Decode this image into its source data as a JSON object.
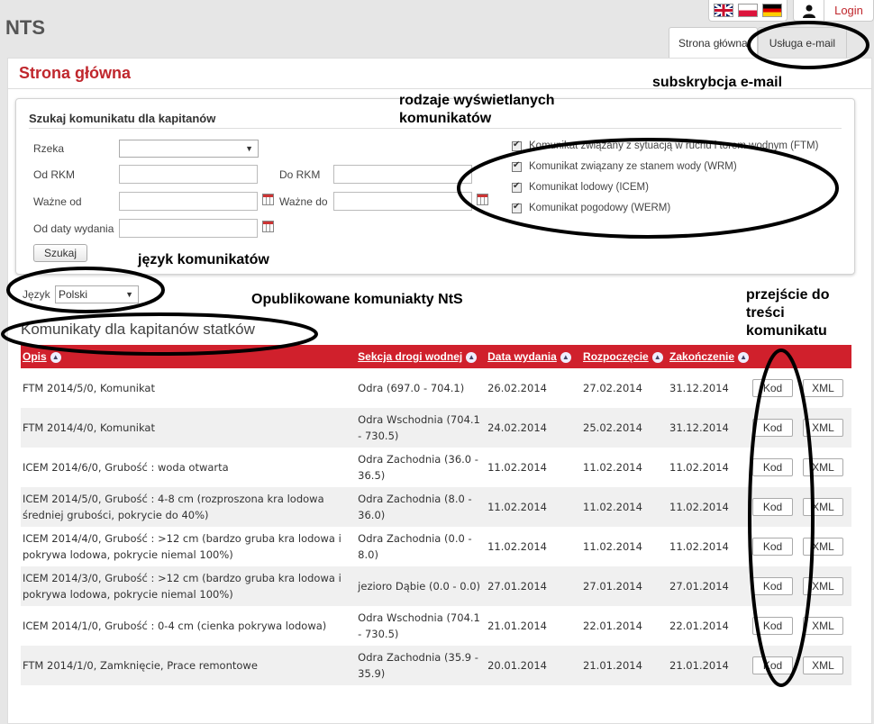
{
  "header": {
    "app_title": "NTS",
    "languages": [
      "flag-uk",
      "flag-pl",
      "flag-de"
    ],
    "login_label": "Login"
  },
  "tabs": [
    {
      "label": "Strona główna",
      "active": true
    },
    {
      "label": "Usługa e-mail",
      "active": false
    }
  ],
  "page": {
    "title": "Strona główna"
  },
  "search": {
    "legend": "Szukaj komunikatu dla kapitanów",
    "river_label": "Rzeka",
    "river_value": "",
    "from_rkm_label": "Od RKM",
    "to_rkm_label": "Do RKM",
    "valid_from_label": "Ważne od",
    "valid_to_label": "Ważne do",
    "issue_date_label": "Od daty wydania",
    "search_button": "Szukaj",
    "checkboxes": [
      {
        "label": "Komunikat związany z sytuacją w ruchu i torem wodnym (FTM)",
        "checked": true
      },
      {
        "label": "Komunikat związany ze stanem wody (WRM)",
        "checked": true
      },
      {
        "label": "Komunikat lodowy (ICEM)",
        "checked": true
      },
      {
        "label": "Komunikat pogodowy (WERM)",
        "checked": true
      }
    ]
  },
  "language_select": {
    "label": "Język",
    "value": "Polski"
  },
  "table": {
    "title": "Komunikaty dla kapitanów statków",
    "columns": [
      "Opis",
      "Sekcja drogi wodnej",
      "Data wydania",
      "Rozpoczęcie",
      "Zakończenie"
    ],
    "kod_label": "Kod",
    "xml_label": "XML",
    "rows": [
      {
        "opis": "FTM 2014/5/0, Komunikat",
        "sekcja": "Odra (697.0 - 704.1)",
        "wydania": "26.02.2014",
        "start": "27.02.2014",
        "end": "31.12.2014"
      },
      {
        "opis": "FTM 2014/4/0, Komunikat",
        "sekcja": "Odra Wschodnia (704.1 - 730.5)",
        "wydania": "24.02.2014",
        "start": "25.02.2014",
        "end": "31.12.2014"
      },
      {
        "opis": "ICEM 2014/6/0, Grubość : woda otwarta",
        "sekcja": "Odra Zachodnia (36.0 - 36.5)",
        "wydania": "11.02.2014",
        "start": "11.02.2014",
        "end": "11.02.2014"
      },
      {
        "opis": "ICEM 2014/5/0, Grubość : 4-8 cm (rozproszona kra lodowa średniej grubości, pokrycie do 40%)",
        "sekcja": "Odra Zachodnia (8.0 - 36.0)",
        "wydania": "11.02.2014",
        "start": "11.02.2014",
        "end": "11.02.2014"
      },
      {
        "opis": "ICEM 2014/4/0, Grubość : >12 cm (bardzo gruba kra lodowa i pokrywa lodowa, pokrycie niemal 100%)",
        "sekcja": "Odra Zachodnia (0.0 - 8.0)",
        "wydania": "11.02.2014",
        "start": "11.02.2014",
        "end": "11.02.2014"
      },
      {
        "opis": "ICEM 2014/3/0, Grubość : >12 cm (bardzo gruba kra lodowa i pokrywa lodowa, pokrycie niemal 100%)",
        "sekcja": "jezioro Dąbie (0.0 - 0.0)",
        "wydania": "27.01.2014",
        "start": "27.01.2014",
        "end": "27.01.2014"
      },
      {
        "opis": "ICEM 2014/1/0, Grubość : 0-4 cm (cienka pokrywa lodowa)",
        "sekcja": "Odra Wschodnia (704.1 - 730.5)",
        "wydania": "21.01.2014",
        "start": "22.01.2014",
        "end": "22.01.2014"
      },
      {
        "opis": "FTM 2014/1/0, Zamknięcie, Prace remontowe",
        "sekcja": "Odra Zachodnia (35.9 - 35.9)",
        "wydania": "20.01.2014",
        "start": "21.01.2014",
        "end": "21.01.2014"
      }
    ]
  },
  "annotations": {
    "email": "subskrybcja e-mail",
    "types": "rodzaje wyświetlanych komunikatów",
    "language": "język komunikatów",
    "published": "Opublikowane komuniakty NtS",
    "goto": "przejście do treści komunikatu"
  }
}
